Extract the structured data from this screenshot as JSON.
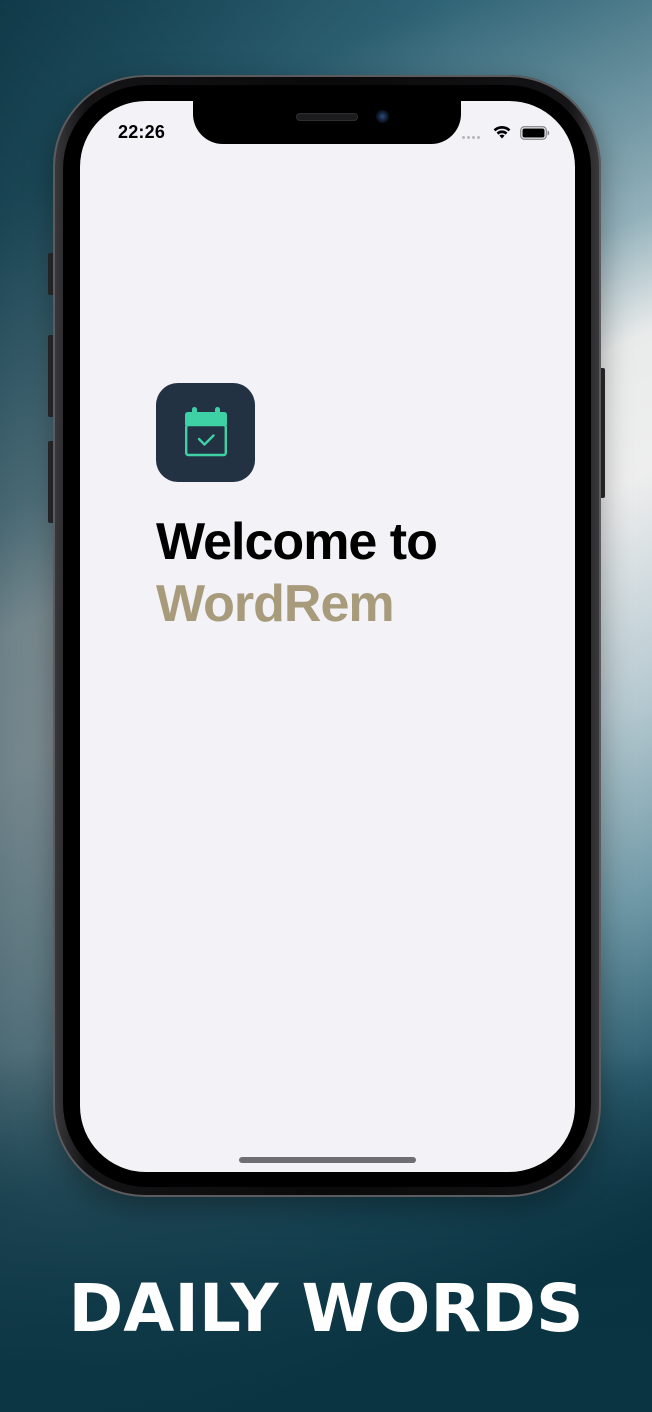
{
  "status_bar": {
    "time": "22:26"
  },
  "app": {
    "icon": "calendar-check-icon",
    "icon_background": "#233242",
    "icon_accent": "#3fd1a6",
    "welcome_text": "Welcome to",
    "app_name": "WordRem",
    "app_name_color": "#a79b7c"
  },
  "promo": {
    "tagline": "DAILY WORDS"
  },
  "colors": {
    "screen_background": "#f2f2f7",
    "background_dark": "#0b3442",
    "background_light": "#eeeeee"
  }
}
